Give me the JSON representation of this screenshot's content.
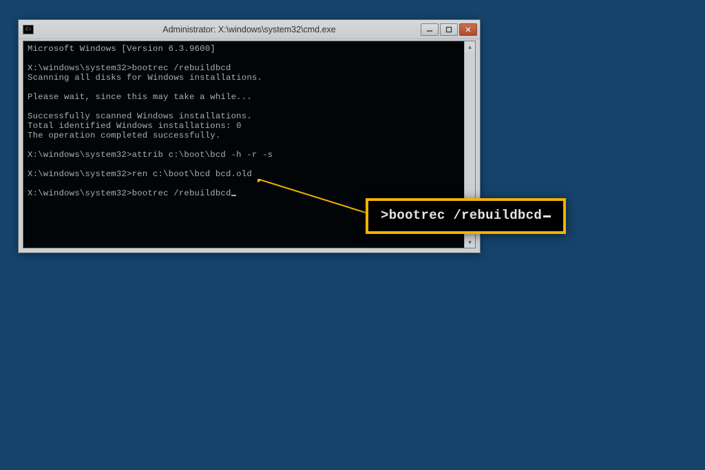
{
  "window": {
    "title": "Administrator: X:\\windows\\system32\\cmd.exe",
    "icon_label": "C:\\"
  },
  "console": {
    "line0": "Microsoft Windows [Version 6.3.9600]",
    "blank": "",
    "l_prompt1": "X:\\windows\\system32>bootrec /rebuildbcd",
    "l_scan": "Scanning all disks for Windows installations.",
    "l_wait": "Please wait, since this may take a while...",
    "l_scan_ok": "Successfully scanned Windows installations.",
    "l_total": "Total identified Windows installations: 0",
    "l_done": "The operation completed successfully.",
    "l_attrib": "X:\\windows\\system32>attrib c:\\boot\\bcd -h -r -s",
    "l_ren": "X:\\windows\\system32>ren c:\\boot\\bcd bcd.old",
    "l_prompt2": "X:\\windows\\system32>bootrec /rebuildbcd"
  },
  "callout": {
    "text": ">bootrec /rebuildbcd"
  }
}
